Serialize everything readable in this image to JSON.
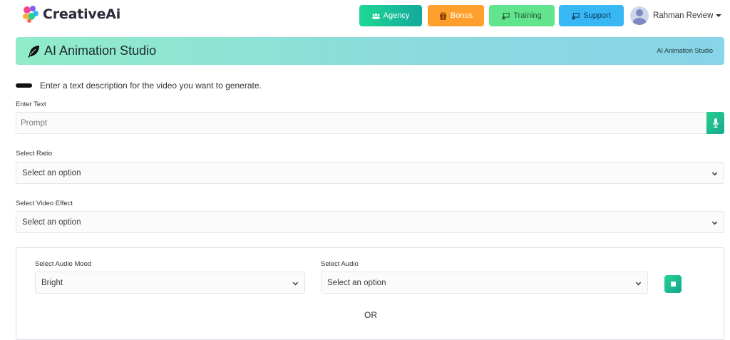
{
  "brand": {
    "name": "Creative",
    "name_suffix": "Ai"
  },
  "nav": {
    "agency": "Agency",
    "bonus": "Bonus",
    "training": "Training",
    "support": "Support"
  },
  "user": {
    "name": "Rahman Review"
  },
  "banner": {
    "title": "AI Animation Studio",
    "breadcrumb": "AI Animation Studio"
  },
  "form": {
    "hint": "Enter a text description for the video you want to generate.",
    "text_label": "Enter Text",
    "text_placeholder": "Prompt",
    "ratio_label": "Select Ratio",
    "ratio_value": "Select an option",
    "effect_label": "Select Video Effect",
    "effect_value": "Select an option",
    "audio_mood_label": "Select Audio Mood",
    "audio_mood_value": "Bright",
    "audio_label": "Select Audio",
    "audio_value": "Select an option",
    "or_text": "OR"
  },
  "colors": {
    "agency": "#1fd793",
    "bonus": "#ffa02c",
    "training": "#62e38e",
    "support": "#38b7f5",
    "accent": "#17a88f"
  },
  "icons": {
    "agency": "users-icon",
    "bonus": "gift-icon",
    "training": "chalkboard-icon",
    "support": "chalkboard-icon",
    "banner": "feather-icon",
    "mic": "microphone-icon",
    "stop": "stop-icon"
  }
}
